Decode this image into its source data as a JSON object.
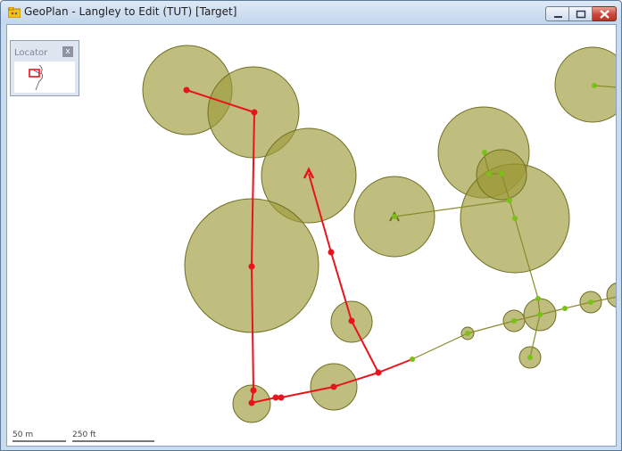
{
  "window": {
    "title": "GeoPlan - Langley to Edit (TUT) [Target]",
    "icon": "geoplan-app-icon"
  },
  "window_controls": {
    "minimize": "minimize-icon",
    "maximize": "maximize-icon",
    "close": "close-icon"
  },
  "locator": {
    "title": "Locator",
    "close_label": "x"
  },
  "scale": {
    "metric": "50 m",
    "imperial": "250 ft"
  },
  "colors": {
    "buffer_fill": "#9c9b3a",
    "buffer_stroke": "#6f6e23",
    "selected_trace": "#e8141b",
    "network_node": "#7ac116",
    "network_link": "#8b8a2a",
    "window_frame": "#c9dbef"
  }
}
